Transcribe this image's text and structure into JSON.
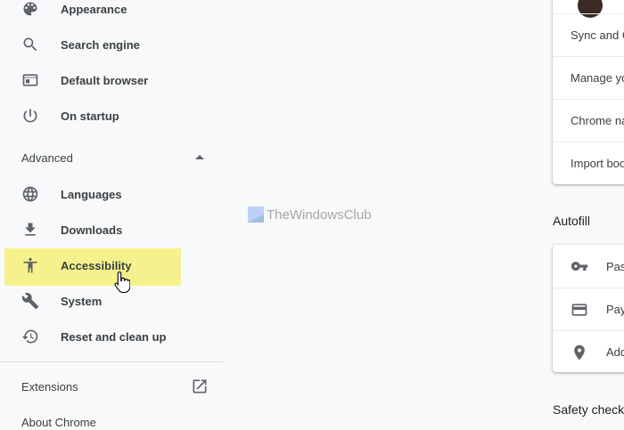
{
  "sidebar": {
    "items_top": [
      {
        "label": "Appearance",
        "icon": "palette-icon"
      },
      {
        "label": "Search engine",
        "icon": "search-icon"
      },
      {
        "label": "Default browser",
        "icon": "browser-window-icon"
      },
      {
        "label": "On startup",
        "icon": "power-icon"
      }
    ],
    "advanced_label": "Advanced",
    "items_advanced": [
      {
        "label": "Languages",
        "icon": "globe-icon"
      },
      {
        "label": "Downloads",
        "icon": "download-icon"
      },
      {
        "label": "Accessibility",
        "icon": "accessibility-icon"
      },
      {
        "label": "System",
        "icon": "wrench-icon"
      },
      {
        "label": "Reset and clean up",
        "icon": "history-icon"
      }
    ],
    "extensions_label": "Extensions",
    "about_label": "About Chrome",
    "highlight_color": "#f5f28d"
  },
  "watermark": {
    "text": "TheWindowsClub"
  },
  "main": {
    "you_and_google_rows": [
      {
        "label": "Sync and G"
      },
      {
        "label": "Manage yo"
      },
      {
        "label": "Chrome na"
      },
      {
        "label": "Import boo"
      }
    ],
    "autofill_title": "Autofill",
    "autofill_rows": [
      {
        "label": "Pas",
        "icon": "key-icon"
      },
      {
        "label": "Pay",
        "icon": "credit-card-icon"
      },
      {
        "label": "Add",
        "icon": "location-pin-icon"
      }
    ],
    "safety_check_title": "Safety check"
  }
}
